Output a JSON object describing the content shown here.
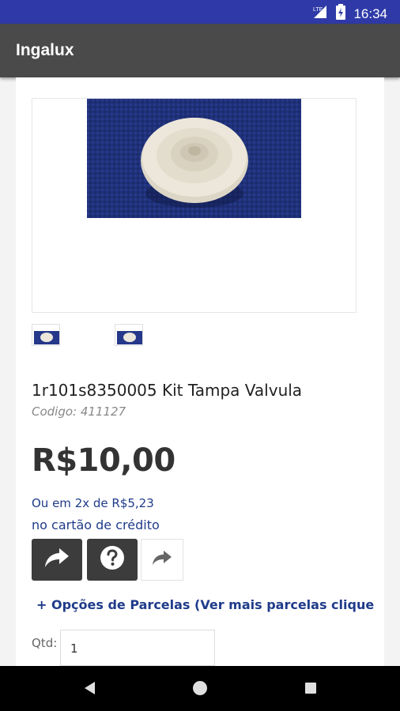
{
  "status_bar": {
    "time": "16:34",
    "network": "LTE",
    "icons": [
      "signal-icon",
      "battery-icon"
    ]
  },
  "app_bar": {
    "title": "Ingalux"
  },
  "product": {
    "title": "1r101s8350005 Kit Tampa Valvula",
    "code": "Codigo: 411127",
    "price": "R$10,00",
    "installment_line1": "Ou em 2x de R$5,23",
    "installment_line2": "no cartão de crédito",
    "images": [
      "main-product-photo",
      "thumbnail-1",
      "thumbnail-2"
    ]
  },
  "actions": {
    "icons": [
      "share-arrow-icon",
      "question-icon",
      "share-icon"
    ]
  },
  "options_link": "+ Opções de Parcelas (Ver mais parcelas clique aqu",
  "quantity": {
    "label": "Qtd:",
    "value": "1"
  },
  "nav_bar": {
    "icons": [
      "back-icon",
      "home-icon",
      "recents-icon"
    ]
  },
  "colors": {
    "status_bar": "#2f3aa8",
    "app_bar": "#4a4a4a",
    "link_blue": "#1f3b8a",
    "button_dark": "#3c3c3c"
  }
}
